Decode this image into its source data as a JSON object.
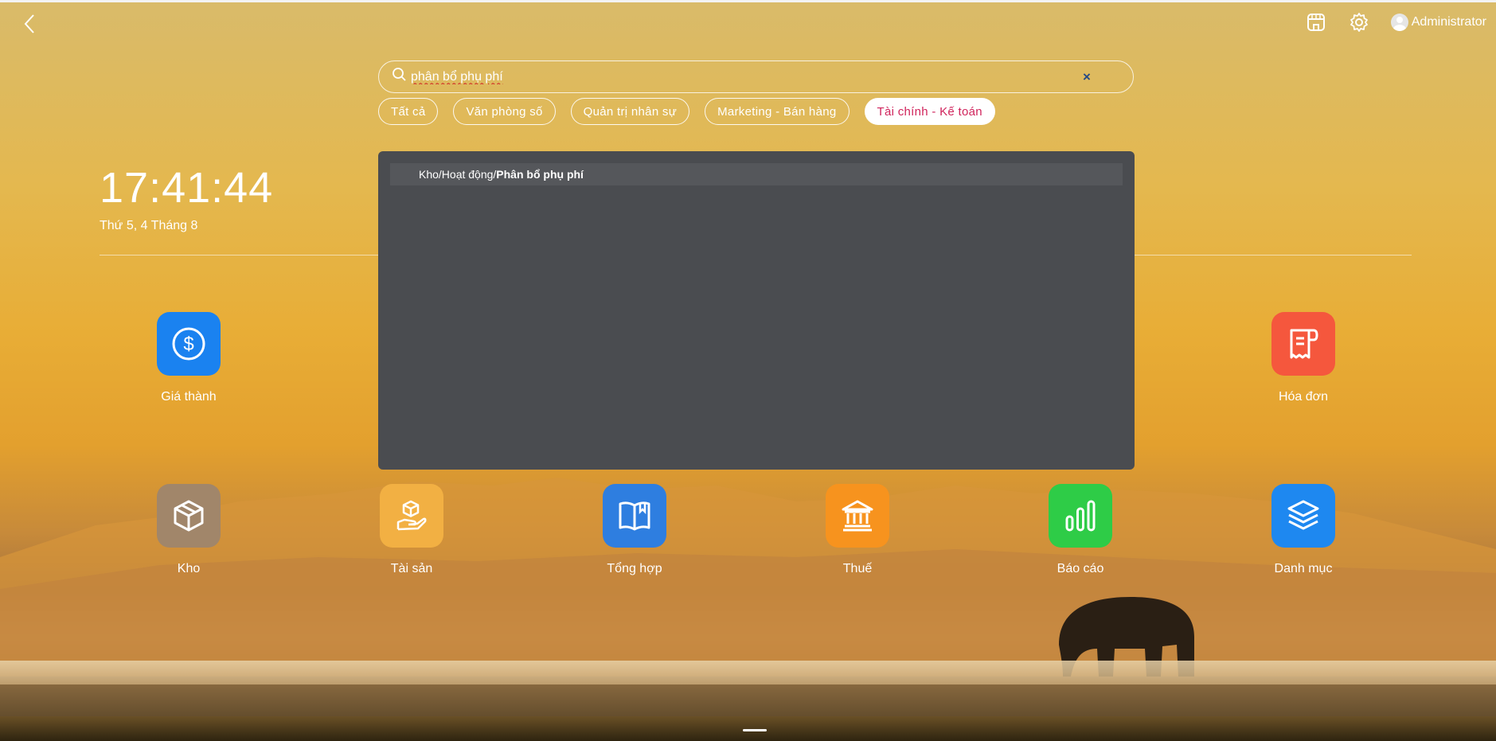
{
  "header": {
    "user_name": "Administrator",
    "back_icon": "chevron-left-icon",
    "store_icon": "store-icon",
    "settings_icon": "gear-icon"
  },
  "search": {
    "value": "phân bổ phụ phí",
    "placeholder": "",
    "clear_label": "×"
  },
  "filters": [
    {
      "label": "Tất cả",
      "active": false
    },
    {
      "label": "Văn phòng số",
      "active": false
    },
    {
      "label": "Quản trị nhân sự",
      "active": false
    },
    {
      "label": "Marketing - Bán hàng",
      "active": false
    },
    {
      "label": "Tài chính - Kế toán",
      "active": true
    }
  ],
  "clock": {
    "time": "17:41:44",
    "date": "Thứ 5, 4 Tháng 8"
  },
  "results": [
    {
      "path": "Kho/Hoạt động/",
      "title": "Phân bổ phụ phí"
    }
  ],
  "apps": [
    {
      "label": "Giá thành",
      "icon": "dollar-icon",
      "color": "#1a82f0"
    },
    {
      "label": "Hóa đơn",
      "icon": "invoice-icon",
      "color": "#f5573d"
    },
    {
      "label": "Kho",
      "icon": "box-icon",
      "color": "#a1866a"
    },
    {
      "label": "Tài sản",
      "icon": "hand-box-icon",
      "color": "#f2b043"
    },
    {
      "label": "Tổng hợp",
      "icon": "book-icon",
      "color": "#2e7ee0"
    },
    {
      "label": "Thuế",
      "icon": "bank-icon",
      "color": "#f7931e"
    },
    {
      "label": "Báo cáo",
      "icon": "bar-chart-icon",
      "color": "#2ecc47"
    },
    {
      "label": "Danh mục",
      "icon": "layers-icon",
      "color": "#1e88f0"
    }
  ],
  "colors": {
    "active_filter_text": "#d0245c",
    "panel_bg": "#4a4c50"
  }
}
